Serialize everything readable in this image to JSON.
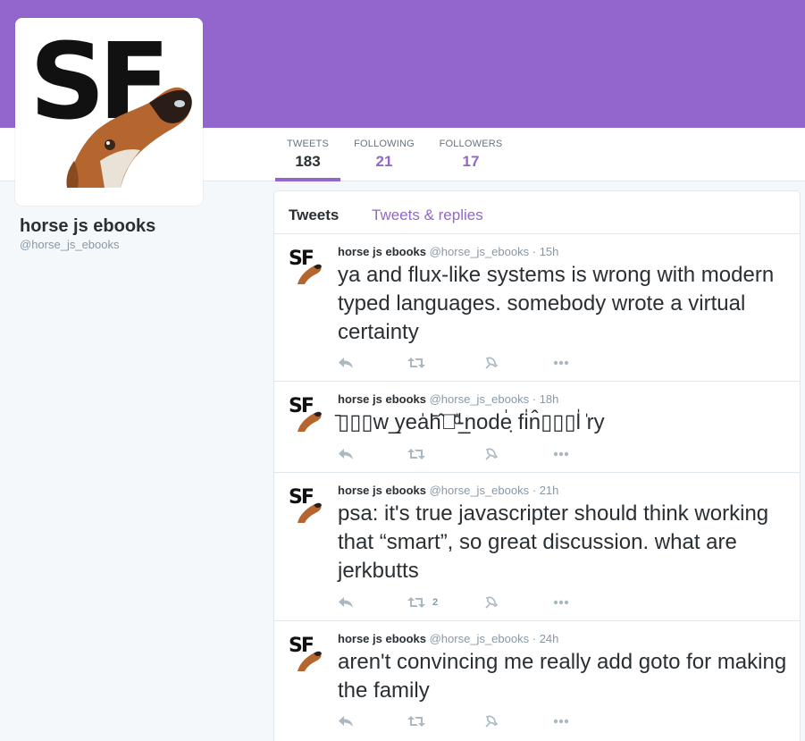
{
  "colors": {
    "accent": "#9266cc",
    "text": "#292f33",
    "muted": "#8899a6",
    "icon": "#aab8c2"
  },
  "profile": {
    "name": "horse js ebooks",
    "handle": "@horse_js_ebooks",
    "avatar_logo_text": "SF"
  },
  "stats": [
    {
      "label": "TWEETS",
      "value": "183"
    },
    {
      "label": "FOLLOWING",
      "value": "21"
    },
    {
      "label": "FOLLOWERS",
      "value": "17"
    }
  ],
  "tabs": [
    {
      "label": "Tweets"
    },
    {
      "label": "Tweets & replies"
    }
  ],
  "tweets": [
    {
      "name": "horse js ebooks",
      "handle": "@horse_js_ebooks",
      "dot": "·",
      "time": "15h",
      "text": "ya and flux-like systems is wrong with modern typed languages. somebody wrote a virtual certainty",
      "retweets": ""
    },
    {
      "name": "horse js ebooks",
      "handle": "@horse_js_ebooks",
      "dot": "·",
      "time": "18h",
      "text": "̄▯▯▯w ̲yea̍h̄̂▯̍ͩ̈-̲node̍ ̣fi̍n̂▯▯▯l̍ ̍ry",
      "retweets": ""
    },
    {
      "name": "horse js ebooks",
      "handle": "@horse_js_ebooks",
      "dot": "·",
      "time": "21h",
      "text": "psa: it's true javascripter should think working that “smart”, so great discussion. what are jerkbutts",
      "retweets": "2"
    },
    {
      "name": "horse js ebooks",
      "handle": "@horse_js_ebooks",
      "dot": "·",
      "time": "24h",
      "text": "aren't convincing me really add goto for making the family",
      "retweets": ""
    }
  ],
  "icons": [
    "reply-icon",
    "retweet-icon",
    "favorite-icon",
    "more-icon"
  ]
}
